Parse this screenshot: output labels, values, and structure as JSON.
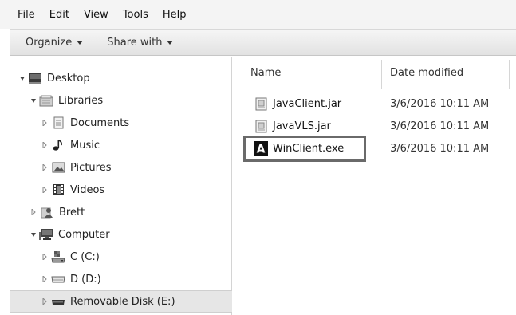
{
  "menu": [
    "File",
    "Edit",
    "View",
    "Tools",
    "Help"
  ],
  "toolbar": {
    "organize_label": "Organize",
    "share_label": "Share with"
  },
  "nav": {
    "items": [
      {
        "label": "Desktop",
        "icon": "desktop-icon",
        "expanded": true
      },
      {
        "label": "Libraries",
        "icon": "libraries-icon",
        "expanded": true
      },
      {
        "label": "Documents",
        "icon": "documents-icon",
        "expanded": false
      },
      {
        "label": "Music",
        "icon": "music-icon",
        "expanded": false
      },
      {
        "label": "Pictures",
        "icon": "pictures-icon",
        "expanded": false
      },
      {
        "label": "Videos",
        "icon": "videos-icon",
        "expanded": false
      },
      {
        "label": "Brett",
        "icon": "user-folder-icon",
        "expanded": false
      },
      {
        "label": "Computer",
        "icon": "computer-icon",
        "expanded": true
      },
      {
        "label": "C (C:)",
        "icon": "hard-drive-icon",
        "expanded": false
      },
      {
        "label": "D (D:)",
        "icon": "optical-drive-icon",
        "expanded": false
      },
      {
        "label": "Removable Disk (E:)",
        "icon": "removable-disk-icon",
        "expanded": false,
        "selected": true
      }
    ]
  },
  "columns": {
    "name": "Name",
    "date_modified": "Date modified"
  },
  "files": [
    {
      "name": "JavaClient.jar",
      "date": "3/6/2016 10:11 AM",
      "icon": "jar-file-icon"
    },
    {
      "name": "JavaVLS.jar",
      "date": "3/6/2016 10:11 AM",
      "icon": "jar-file-icon"
    },
    {
      "name": "WinClient.exe",
      "date": "3/6/2016 10:11 AM",
      "icon": "exe-app-icon",
      "highlighted": true
    }
  ],
  "exe_icon_letter": "A"
}
